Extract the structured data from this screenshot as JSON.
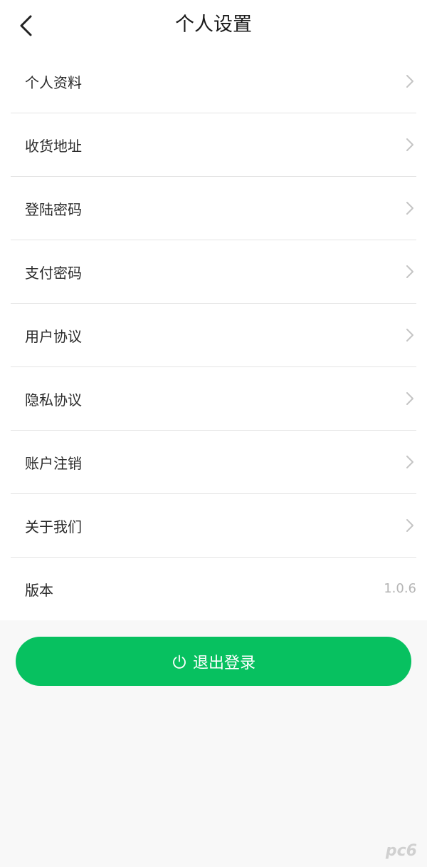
{
  "header": {
    "title": "个人设置",
    "back_icon": "chevron-left-icon"
  },
  "menu": {
    "items": [
      {
        "label": "个人资料",
        "icon": "chevron-right-icon"
      },
      {
        "label": "收货地址",
        "icon": "chevron-right-icon"
      },
      {
        "label": "登陆密码",
        "icon": "chevron-right-icon"
      },
      {
        "label": "支付密码",
        "icon": "chevron-right-icon"
      },
      {
        "label": "用户协议",
        "icon": "chevron-right-icon"
      },
      {
        "label": "隐私协议",
        "icon": "chevron-right-icon"
      },
      {
        "label": "账户注销",
        "icon": "chevron-right-icon"
      },
      {
        "label": "关于我们",
        "icon": "chevron-right-icon"
      }
    ],
    "version": {
      "label": "版本",
      "value": "1.0.6"
    }
  },
  "logout": {
    "label": "退出登录",
    "icon": "power-icon",
    "color": "#07c160"
  },
  "watermark": {
    "text": "pc6"
  }
}
